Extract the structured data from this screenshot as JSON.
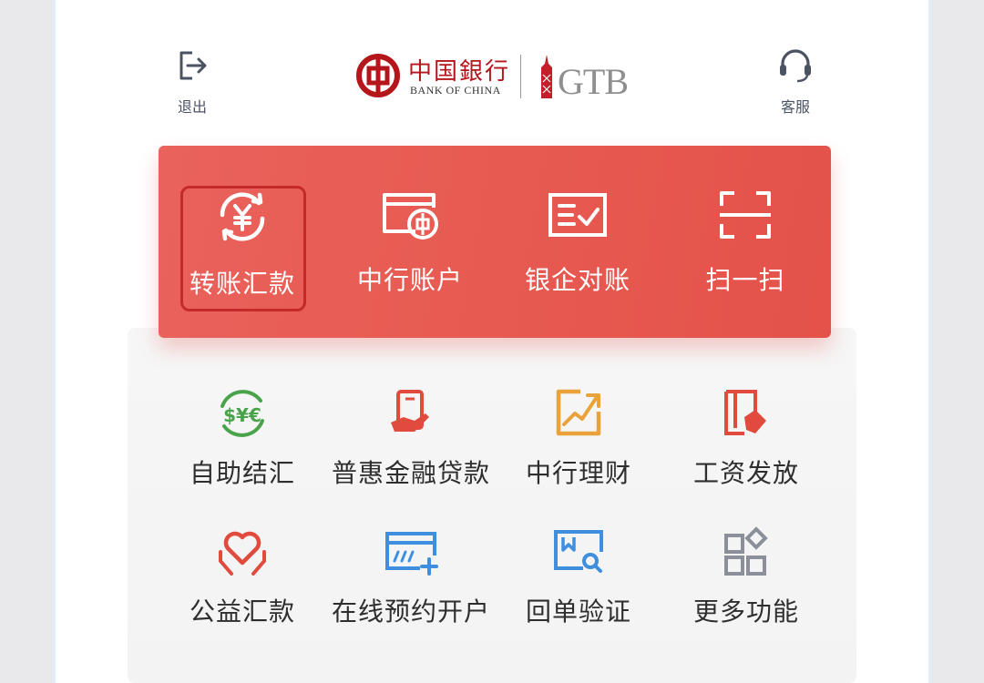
{
  "header": {
    "logout_label": "退出",
    "service_label": "客服",
    "logo": {
      "bank_name_cn": "中国銀行",
      "bank_name_en": "BANK OF CHINA",
      "gtb": "GTB"
    }
  },
  "banner": {
    "items": [
      {
        "label": "转账汇款",
        "icon": "transfer-yuan-icon"
      },
      {
        "label": "中行账户",
        "icon": "bank-account-card-icon"
      },
      {
        "label": "银企对账",
        "icon": "reconciliation-document-icon"
      },
      {
        "label": "扫一扫",
        "icon": "scan-icon"
      }
    ],
    "selected_index": 0
  },
  "grid": {
    "items": [
      {
        "label": "自助结汇",
        "icon": "currency-exchange-icon",
        "color": "#49a34a"
      },
      {
        "label": "普惠金融贷款",
        "icon": "loan-phone-hand-icon",
        "color": "#e04b3e"
      },
      {
        "label": "中行理财",
        "icon": "wealth-chart-icon",
        "color": "#eaa23a"
      },
      {
        "label": "工资发放",
        "icon": "payroll-document-icon",
        "color": "#e04b3e"
      },
      {
        "label": "公益汇款",
        "icon": "charity-heart-hands-icon",
        "color": "#e04b3e"
      },
      {
        "label": "在线预约开户",
        "icon": "online-account-card-icon",
        "color": "#3f8fe0"
      },
      {
        "label": "回单验证",
        "icon": "receipt-verify-icon",
        "color": "#3f8fe0"
      },
      {
        "label": "更多功能",
        "icon": "more-functions-grid-icon",
        "color": "#8a8f99"
      }
    ]
  },
  "colors": {
    "banner_red": "#e75b52",
    "brand_red": "#b4161b"
  }
}
